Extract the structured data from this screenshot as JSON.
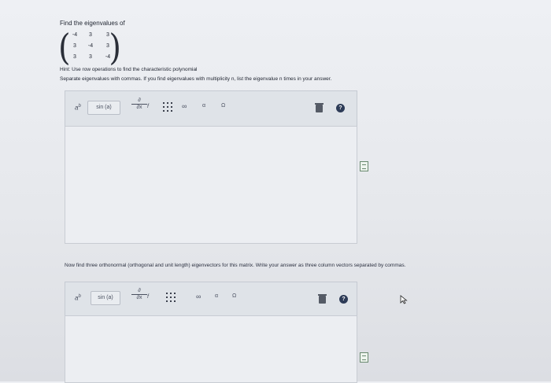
{
  "question1": {
    "title": "Find the eigenvalues of",
    "matrix": [
      [
        "-4",
        "3",
        "3"
      ],
      [
        "3",
        "-4",
        "3"
      ],
      [
        "3",
        "3",
        "-4"
      ]
    ],
    "hint": "Hint: Use row operations to find the characteristic polynomial",
    "instruction": "Separate eigenvalues with commas. If you find eigenvalues with multiplicity n, list the eigenvalue n times in your answer."
  },
  "question2": {
    "text": "Now find three orthonormal (orthogonal and unit length) eigenvectors for this matrix. Write your answer as three column vectors separated by commas."
  },
  "toolbar": {
    "power_label": "a",
    "power_sup": "b",
    "sin_label": "sin (a)",
    "deriv_top": "∂",
    "deriv_bottom": "∂x",
    "deriv_f": "f",
    "infinity": "∞",
    "alpha": "α",
    "omega": "Ω",
    "help": "?"
  },
  "icons": [
    "matrix-grid-icon",
    "trash-icon",
    "help-icon",
    "document-icon",
    "cursor-icon"
  ]
}
